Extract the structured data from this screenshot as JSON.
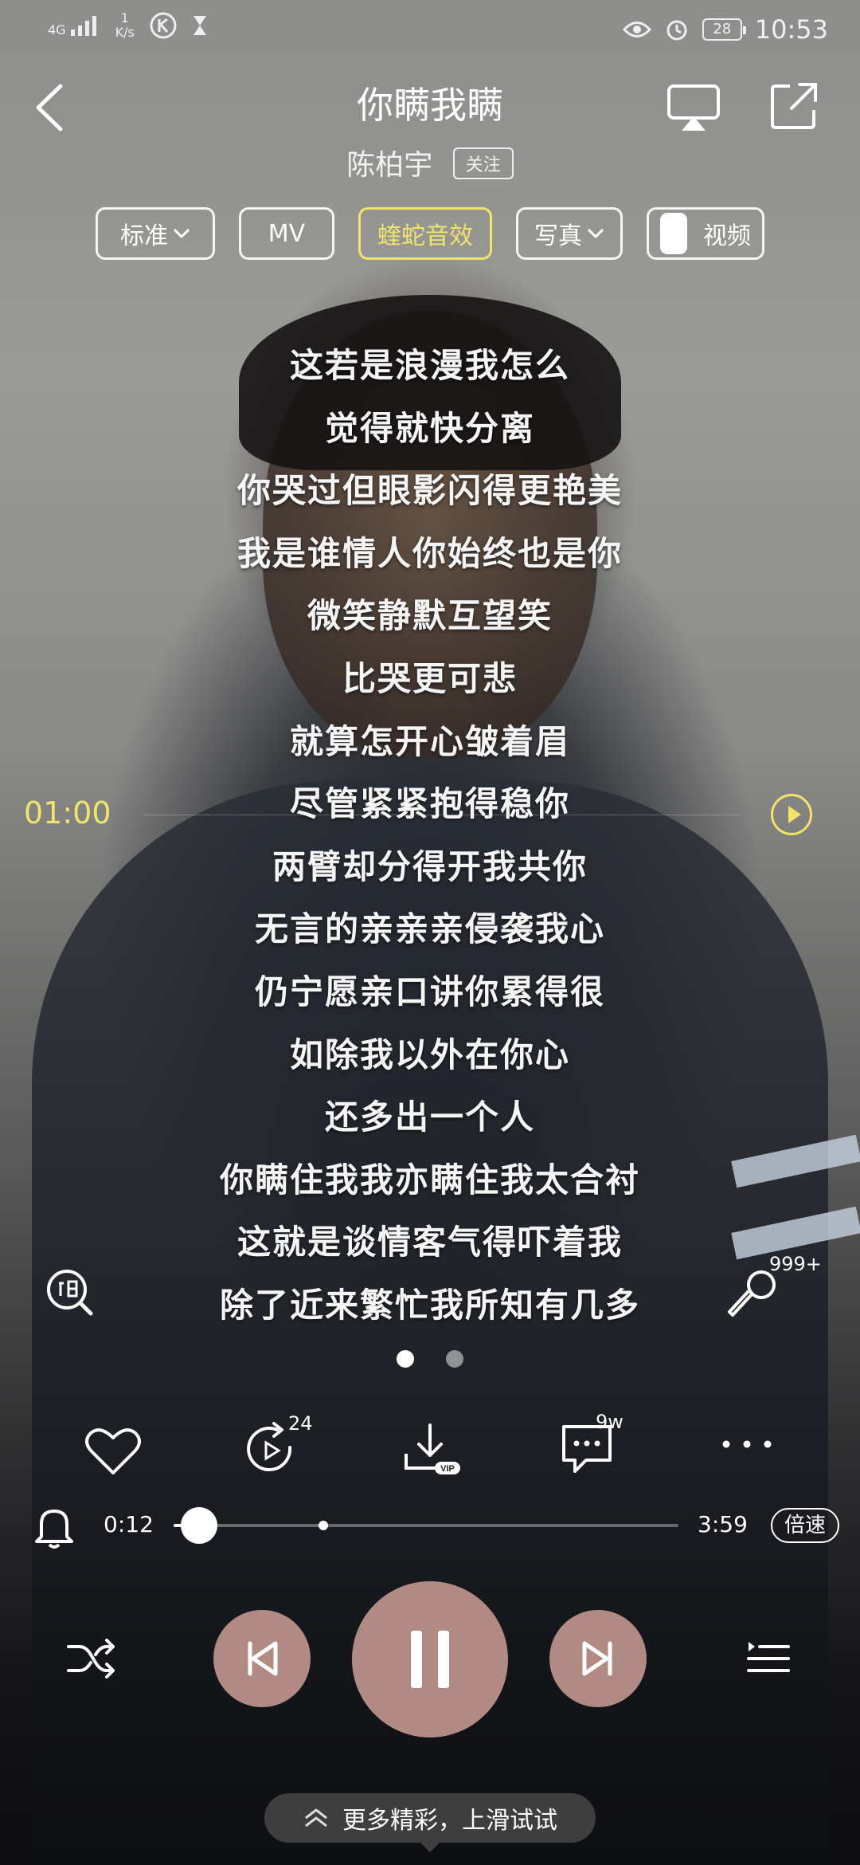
{
  "status_bar": {
    "network": "4G",
    "speed_value": "1",
    "speed_unit": "K/s",
    "battery": "28",
    "time": "10:53"
  },
  "header": {
    "song_title": "你瞒我瞒",
    "artist": "陈柏宇",
    "follow_label": "关注"
  },
  "chips": {
    "quality_label": "标准",
    "mv_label": "MV",
    "effect_label": "蝰蛇音效",
    "photo_label": "写真",
    "video_label": "视频"
  },
  "lyrics": [
    "这若是浪漫我怎么",
    "觉得就快分离",
    "你哭过但眼影闪得更艳美",
    "我是谁情人你始终也是你",
    "微笑静默互望笑",
    "比哭更可悲",
    "就算怎开心皱着眉",
    "尽管紧紧抱得稳你",
    "两臂却分得开我共你",
    "无言的亲亲亲侵袭我心",
    "仍宁愿亲口讲你累得很",
    "如除我以外在你心",
    "还多出一个人",
    "你瞒住我我亦瞒住我太合衬",
    "这就是谈情客气得吓着我",
    "除了近来繁忙我所知有几多"
  ],
  "lyric_seek_time": "01:00",
  "mic_count": "999+",
  "actions": {
    "loop_count": "24",
    "comment_count": "9w",
    "download_badge": "VIP"
  },
  "progress": {
    "elapsed": "0:12",
    "total": "3:59",
    "fraction": 0.05,
    "speed_label": "倍速"
  },
  "swipe_hint": "更多精彩，上滑试试",
  "colors": {
    "accent": "#f1e46d",
    "control_bg": "#b28a84"
  }
}
